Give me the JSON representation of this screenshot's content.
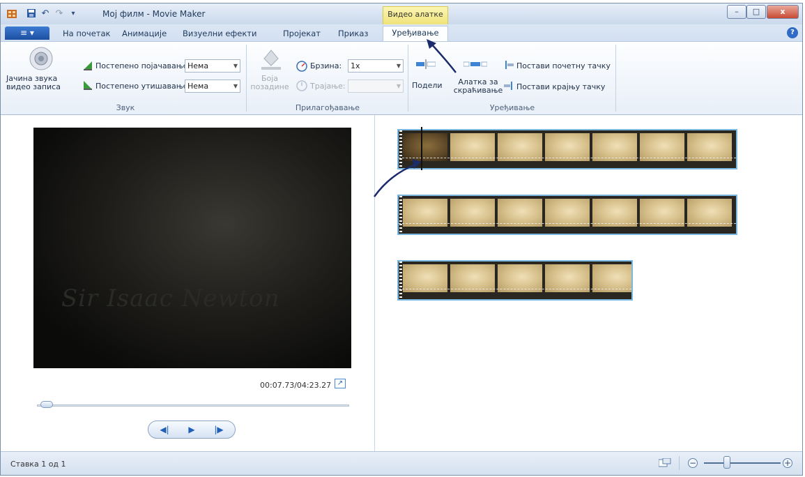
{
  "window": {
    "title": "Мој филм - Movie Maker",
    "context_group": "Видео алатке",
    "buttons": {
      "minimize": "–",
      "maximize": "□",
      "close": "x"
    }
  },
  "quick_access": [
    "film-icon",
    "save-icon",
    "undo-icon",
    "redo-icon",
    "customize-icon"
  ],
  "tabs": {
    "file_menu": "≡ ▾",
    "items": [
      "На почетак",
      "Анимације",
      "Визуелни ефекти",
      "Пројекат",
      "Приказ"
    ],
    "active": "Уређивање",
    "help": "?"
  },
  "ribbon": {
    "audio": {
      "volume_label": "Јачина звука видео записа",
      "fade_in_label": "Постепено појачавање:",
      "fade_in_value": "Нема",
      "fade_out_label": "Постепено утишавање:",
      "fade_out_value": "Нема",
      "group_label": "Звук"
    },
    "adjust": {
      "bg_color_label": "Боја позадине",
      "speed_label": "Брзина:",
      "speed_value": "1x",
      "duration_label": "Трајање:",
      "duration_value": "",
      "group_label": "Прилагођавање"
    },
    "editing": {
      "split_label": "Подели",
      "trim_label": "Алатка за скраћивање",
      "set_start_label": "Постави почетну тачку",
      "set_end_label": "Постави крајњу тачку",
      "group_label": "Уређивање"
    }
  },
  "preview": {
    "video_text": "Sir Isaac Newton",
    "timecode": "00:07.73/04:23.27",
    "seek_progress": 0.015,
    "controls": {
      "prev": "◀|",
      "play": "▶",
      "next": "|▶"
    }
  },
  "storyboard": {
    "clips": [
      {
        "frames": 7,
        "selected": true
      },
      {
        "frames": 7,
        "selected": false
      },
      {
        "frames": 5,
        "selected": false
      }
    ]
  },
  "status": {
    "text": "Ставка 1 од 1",
    "zoom_minus": "−",
    "zoom_plus": "+",
    "zoom_level": 0.3
  },
  "colors": {
    "accent": "#2f6ac6",
    "context_tab": "#efe27a",
    "annotation_arrow": "#1b2a6b"
  }
}
